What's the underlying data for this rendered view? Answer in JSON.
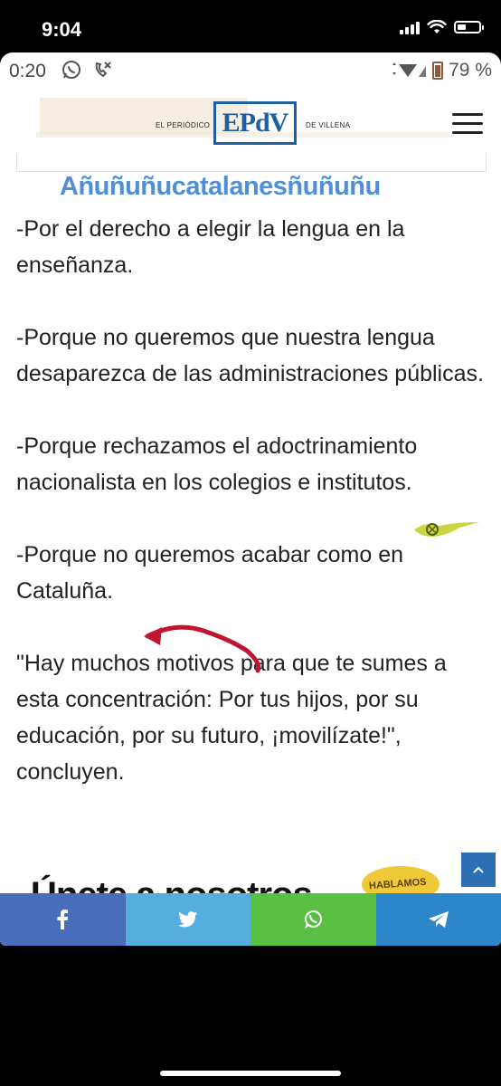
{
  "ios_status": {
    "time": "9:04"
  },
  "android_status": {
    "time": "0:20",
    "battery": "79 %"
  },
  "site": {
    "brand_left": "EL PERIÓDICO",
    "logo": "EPdV",
    "brand_right": "DE VILLENA"
  },
  "overlay_title": "Añuñuñucatalanesñuñuñu",
  "article": {
    "paragraphs": [
      "-Por el derecho a elegir la lengua en la enseñanza.",
      "-Porque no queremos que nuestra lengua desaparezca de las administraciones públicas.",
      "-Porque rechazamos el adoctrinamiento nacionalista en los colegios e institutos.",
      "-Porque no queremos acabar como en Cataluña.",
      "\"Hay muchos motivos para que te sumes a esta concentración: Por tus hijos, por su educación, por su futuro, ¡movilízate!\", concluyen."
    ]
  },
  "join_banner": {
    "text": "Únete a nosotros",
    "badge": "HABLAMOS"
  },
  "share_bar": [
    {
      "name": "facebook",
      "icon": "facebook-icon",
      "color": "#4a6dbb"
    },
    {
      "name": "twitter",
      "icon": "twitter-icon",
      "color": "#56aee0"
    },
    {
      "name": "whatsapp",
      "icon": "whatsapp-icon",
      "color": "#58c144"
    },
    {
      "name": "telegram",
      "icon": "telegram-icon",
      "color": "#2c86c8"
    }
  ],
  "colors": {
    "accent": "#1d5fa0",
    "overlay_title": "#4e8fd8",
    "annotation_arrow": "#c0152c"
  }
}
